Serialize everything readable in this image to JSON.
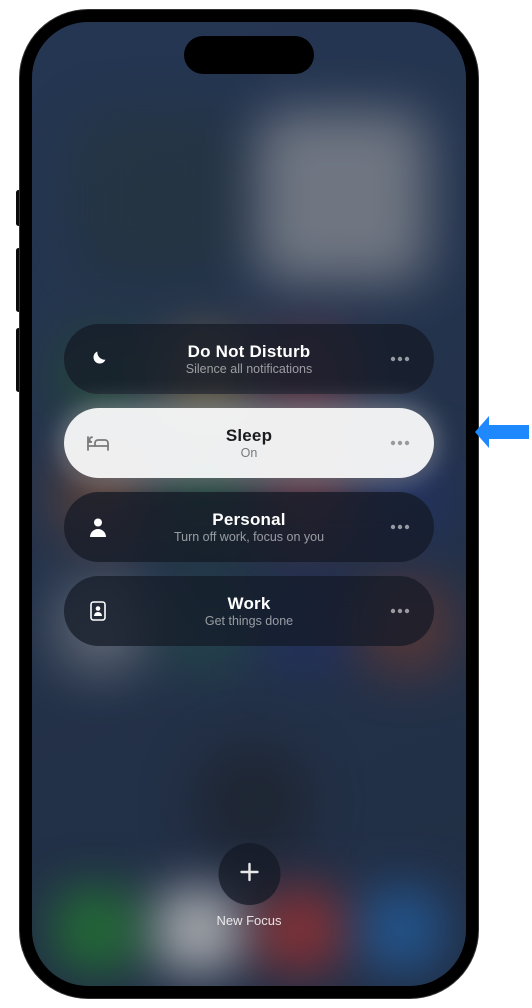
{
  "focus_modes": [
    {
      "id": "dnd",
      "title": "Do Not Disturb",
      "subtitle": "Silence all notifications",
      "icon": "moon",
      "active": false
    },
    {
      "id": "sleep",
      "title": "Sleep",
      "subtitle": "On",
      "icon": "bed",
      "active": true
    },
    {
      "id": "personal",
      "title": "Personal",
      "subtitle": "Turn off work, focus on you",
      "icon": "person",
      "active": false
    },
    {
      "id": "work",
      "title": "Work",
      "subtitle": "Get things done",
      "icon": "badge",
      "active": false
    }
  ],
  "new_focus": {
    "label": "New Focus"
  },
  "annotation": {
    "points_to": "sleep",
    "description": "arrow pointing at Sleep focus mode"
  }
}
